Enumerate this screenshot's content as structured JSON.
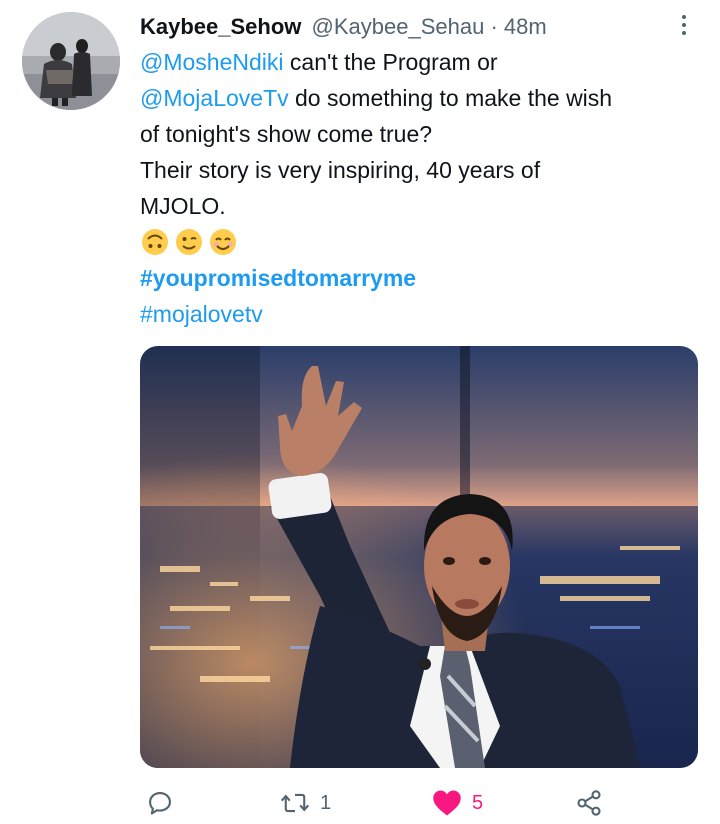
{
  "tweet": {
    "display_name": "Kaybee_Sehow",
    "handle": "@Kaybee_Sehau",
    "separator": " · ",
    "time": "48m",
    "line1_mention": "@MosheNdiki",
    "line1_text": " can't the Program or",
    "line2_mention": "@MojaLoveTv",
    "line2_text": " do something to make the wish",
    "line3_text": "of tonight's show come true?",
    "line4_text": "Their story is very inspiring, 40 years of",
    "line5_text": "MJOLO.",
    "emojis": [
      "upside-down-face",
      "winking-face",
      "smiling-face-with-smiling-eyes"
    ],
    "hashtag1": "#youpromisedtomarryme",
    "hashtag2": "#mojalovetv"
  },
  "actions": {
    "reply_count": "",
    "retweet_count": "1",
    "like_count": "5"
  },
  "colors": {
    "link": "#1d9bf0",
    "like": "#f91880",
    "muted": "#536471",
    "text": "#0f1419"
  }
}
